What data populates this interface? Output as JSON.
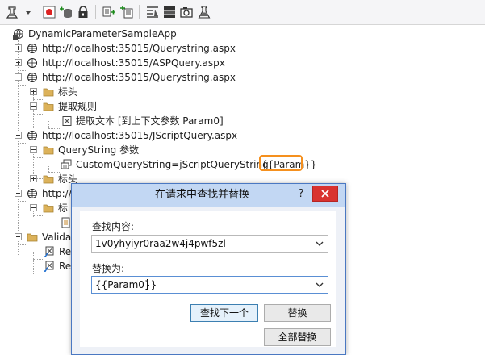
{
  "tree": {
    "root": "DynamicParameterSampleApp",
    "items": [
      "http://localhost:35015/Querystring.aspx",
      "http://localhost:35015/ASPQuery.aspx",
      "http://localhost:35015/Querystring.aspx",
      "标头",
      "提取规则",
      "提取文本 [到上下文参数 Param0]",
      "http://localhost:35015/JScriptQuery.aspx",
      "QueryString 参数",
      "CustomQueryString=jScriptQueryString__",
      "{{Param}}",
      "标头",
      "http://",
      "标",
      "Valida",
      "Re",
      "Re"
    ]
  },
  "dialog": {
    "title": "在请求中查找并替换",
    "help": "?",
    "find_label": "查找内容:",
    "find_value": "1v0yhyiyr0raa2w4j4pwf5zl",
    "replace_label": "替换为:",
    "replace_value": "{{Param0}}",
    "find_next_button": "查找下一个",
    "replace_button": "替换",
    "replace_all_button": "全部替换"
  },
  "colors": {
    "highlight": "#f5901e",
    "close": "#d9322f",
    "title_bar": "#c2d7f3",
    "folder": "#dcb25a"
  }
}
